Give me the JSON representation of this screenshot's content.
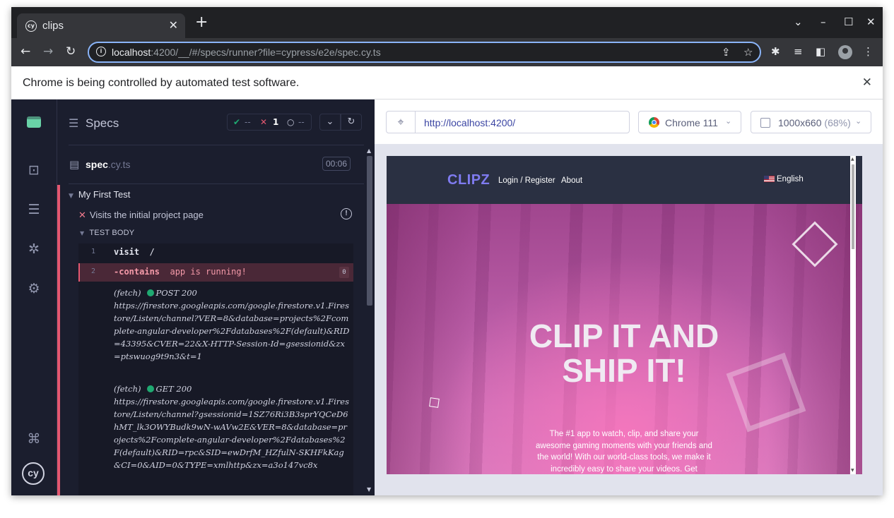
{
  "browser": {
    "tab_title": "clips",
    "favicon_text": "cy",
    "address": {
      "host": "localhost",
      "rest": ":4200/__/#/specs/runner?file=cypress/e2e/spec.cy.ts"
    },
    "infobar_text": "Chrome is being controlled by automated test software."
  },
  "reporter": {
    "header_title": "Specs",
    "stats": {
      "passed": "--",
      "failed": "1",
      "pending": "--"
    },
    "spec_file": {
      "name": "spec",
      "ext": ".cy.ts",
      "duration": "00:06"
    },
    "suite_title": "My First Test",
    "test_title": "Visits the initial project page",
    "test_body_label": "TEST BODY",
    "commands": [
      {
        "num": "1",
        "name": "visit",
        "arg": "/"
      },
      {
        "num": "2",
        "name": "-contains",
        "arg": "app is running!",
        "count": "0"
      }
    ],
    "logs": [
      {
        "prefix": "(fetch)",
        "method": "POST 200",
        "url": "https://firestore.googleapis.com/google.firestore.v1.Firestore/Listen/channel?VER=8&database=projects%2Fcomplete-angular-developer%2Fdatabases%2F(default)&RID=43395&CVER=22&X-HTTP-Session-Id=gsessionid&zx=ptswuog9t9n3&t=1"
      },
      {
        "prefix": "(fetch)",
        "method": "GET 200",
        "url": "https://firestore.googleapis.com/google.firestore.v1.Firestore/Listen/channel?gsessionid=1SZ76Ri3B3sprYQCeD6hMT_lk3OWYBudk9wN-wAVw2E&VER=8&database=projects%2Fcomplete-angular-developer%2Fdatabases%2F(default)&RID=rpc&SID=ewDrfM_HZfulN-SKHFkKag&CI=0&AID=0&TYPE=xmlhttp&zx=a3o147vc8x"
      }
    ]
  },
  "aut": {
    "url": "http://localhost:4200/",
    "browser_label": "Chrome 111",
    "viewport_label": "1000x660",
    "viewport_pct": "(68%)"
  },
  "app": {
    "brand": "CLIPZ",
    "nav_login": "Login / Register",
    "nav_about": "About",
    "language": "English",
    "hero_title": "CLIP IT AND SHIP IT!",
    "hero_sub": "The #1 app to watch, clip, and share your awesome gaming moments with your friends and the world! With our world-class tools, we make it incredibly easy to share your videos. Get"
  },
  "icons": {
    "nav": [
      "cypress-logo-icon",
      "specs-icon",
      "runs-icon",
      "debug-icon",
      "settings-icon",
      "keyboard-shortcuts-icon",
      "cypress-account-icon"
    ]
  }
}
